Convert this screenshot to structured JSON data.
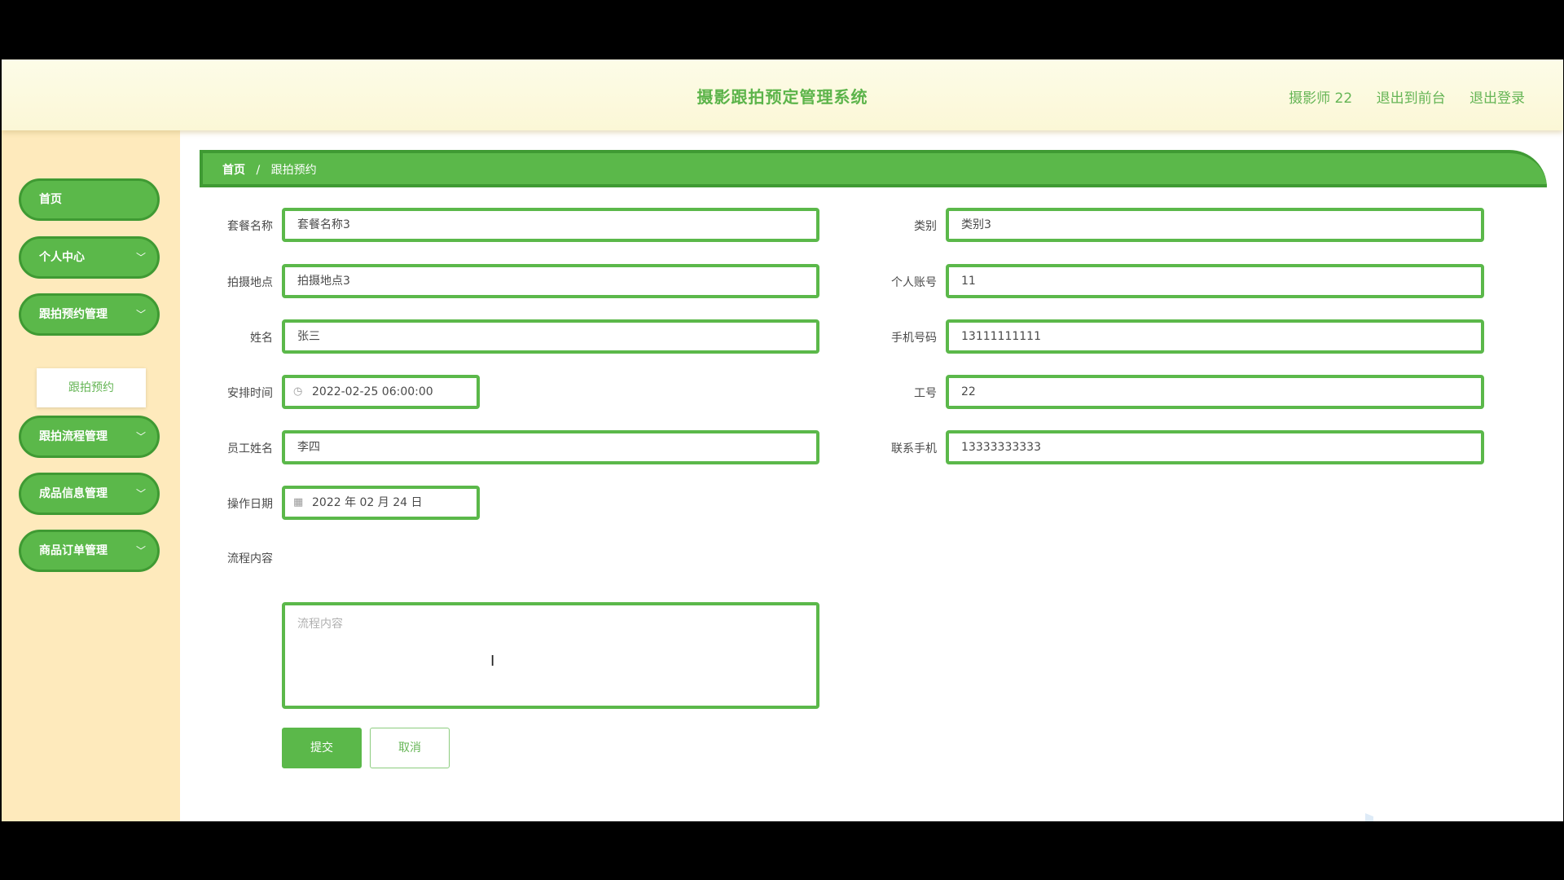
{
  "header": {
    "title": "摄影跟拍预定管理系统",
    "user": "摄影师 22",
    "to_frontend": "退出到前台",
    "logout": "退出登录"
  },
  "sidebar": {
    "items": [
      {
        "label": "首页"
      },
      {
        "label": "个人中心"
      },
      {
        "label": "跟拍预约管理"
      },
      {
        "label": "跟拍流程管理"
      },
      {
        "label": "成品信息管理"
      },
      {
        "label": "商品订单管理"
      }
    ],
    "submenu": {
      "label": "跟拍预约"
    }
  },
  "breadcrumb": {
    "home": "首页",
    "separator": "/",
    "current": "跟拍预约"
  },
  "form": {
    "package_name": {
      "label": "套餐名称",
      "value": "套餐名称3"
    },
    "category": {
      "label": "类别",
      "value": "类别3"
    },
    "location": {
      "label": "拍摄地点",
      "value": "拍摄地点3"
    },
    "account": {
      "label": "个人账号",
      "value": "11"
    },
    "name": {
      "label": "姓名",
      "value": "张三"
    },
    "phone": {
      "label": "手机号码",
      "value": "13111111111"
    },
    "schedule_time": {
      "label": "安排时间",
      "value": "2022-02-25 06:00:00"
    },
    "employee_id": {
      "label": "工号",
      "value": "22"
    },
    "employee_name": {
      "label": "员工姓名",
      "value": "李四"
    },
    "contact_phone": {
      "label": "联系手机",
      "value": "13333333333"
    },
    "operation_date": {
      "label": "操作日期",
      "value": "2022 年 02 月 24 日"
    },
    "process_content": {
      "label": "流程内容",
      "placeholder": "流程内容"
    }
  },
  "buttons": {
    "submit": "提交",
    "cancel": "取消"
  },
  "colors": {
    "accent": "#5bb84a",
    "accent_dark": "#3f9a33",
    "sidebar_bg": "#feeabc",
    "topbar_bg": "#fbf7d6"
  }
}
